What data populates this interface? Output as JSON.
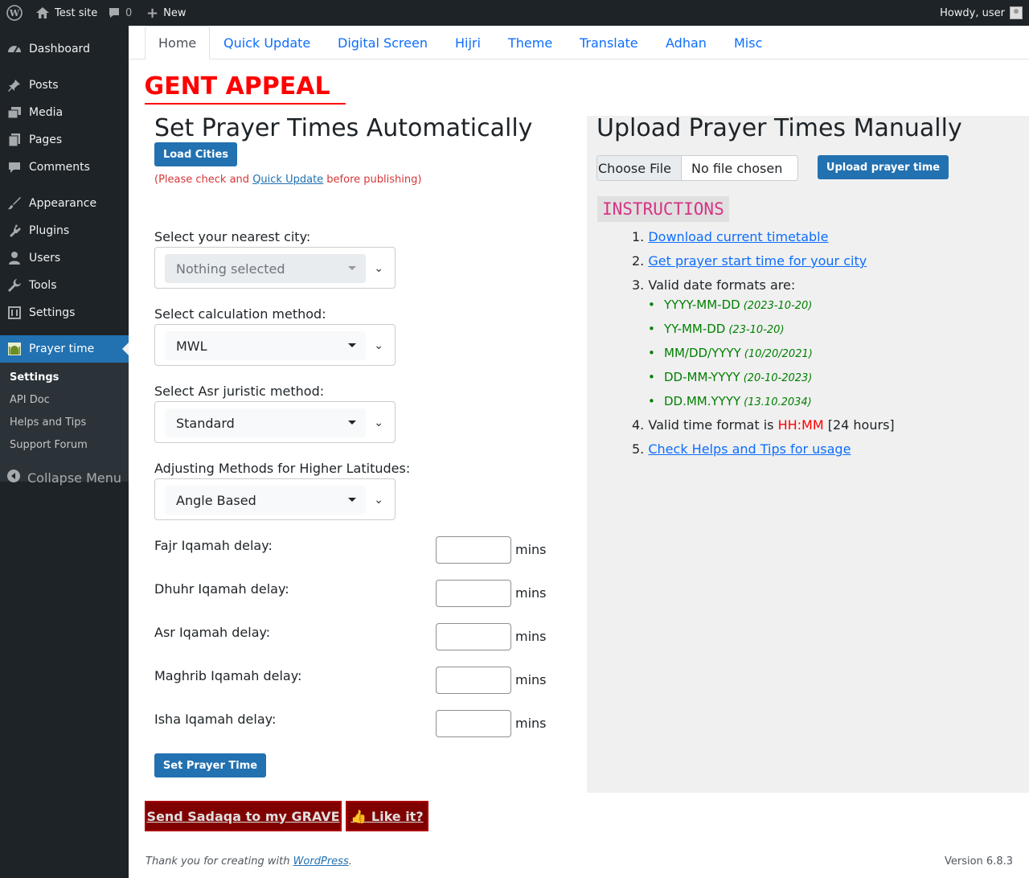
{
  "adminbar": {
    "site_name": "Test site",
    "comments_count": "0",
    "new_label": "New",
    "howdy": "Howdy, user"
  },
  "sidebar": {
    "items": [
      {
        "label": "Dashboard",
        "icon": "dashboard-icon"
      },
      {
        "label": "Posts",
        "icon": "pin-icon"
      },
      {
        "label": "Media",
        "icon": "media-icon"
      },
      {
        "label": "Pages",
        "icon": "pages-icon"
      },
      {
        "label": "Comments",
        "icon": "comment-icon"
      },
      {
        "label": "Appearance",
        "icon": "brush-icon"
      },
      {
        "label": "Plugins",
        "icon": "plug-icon"
      },
      {
        "label": "Users",
        "icon": "user-icon"
      },
      {
        "label": "Tools",
        "icon": "wrench-icon"
      },
      {
        "label": "Settings",
        "icon": "sliders-icon"
      },
      {
        "label": "Prayer time",
        "icon": "mosque-icon"
      }
    ],
    "submenu": [
      "Settings",
      "API Doc",
      "Helps and Tips",
      "Support Forum"
    ],
    "collapse_label": "Collapse Menu"
  },
  "tabs": [
    "Home",
    "Quick Update",
    "Digital Screen",
    "Hijri",
    "Theme",
    "Translate",
    "Adhan",
    "Misc"
  ],
  "marquee_text": "URGENT APPEAL",
  "auto": {
    "title": "Set Prayer Times Automatically",
    "load_cities": "Load Cities",
    "note_prefix": "(Please check and ",
    "note_link": "Quick Update",
    "note_suffix": " before publishing)",
    "city_label": "Select your nearest city:",
    "city_value": "Nothing selected",
    "method_label": "Select calculation method:",
    "method_value": "MWL",
    "asr_label": "Select Asr juristic method:",
    "asr_value": "Standard",
    "lat_label": "Adjusting Methods for Higher Latitudes:",
    "lat_value": "Angle Based",
    "iqamah": [
      {
        "label": "Fajr Iqamah delay:",
        "value": ""
      },
      {
        "label": "Dhuhr Iqamah delay:",
        "value": ""
      },
      {
        "label": "Asr Iqamah delay:",
        "value": ""
      },
      {
        "label": "Maghrib Iqamah delay:",
        "value": ""
      },
      {
        "label": "Isha Iqamah delay:",
        "value": ""
      }
    ],
    "unit": "mins",
    "submit": "Set Prayer Time"
  },
  "manual": {
    "title": "Upload Prayer Times Manually",
    "choose_file": "Choose File",
    "no_file": "No file chosen",
    "upload_btn": "Upload prayer time",
    "instructions_title": "INSTRUCTIONS",
    "steps": {
      "s1": "Download current timetable",
      "s2": "Get prayer start time for your city",
      "s3": "Valid date formats are:",
      "s4_prefix": "Valid time format is ",
      "s4_highlight": "HH:MM",
      "s4_suffix": " [24 hours]",
      "s5": "Check Helps and Tips for usage"
    },
    "formats": [
      {
        "fmt": "YYYY-MM-DD",
        "ex": "(2023-10-20)"
      },
      {
        "fmt": "YY-MM-DD",
        "ex": "(23-10-20)"
      },
      {
        "fmt": "MM/DD/YYYY",
        "ex": "(10/20/2021)"
      },
      {
        "fmt": "DD-MM-YYYY",
        "ex": "(20-10-2023)"
      },
      {
        "fmt": "DD.MM.YYYY",
        "ex": "(13.10.2034)"
      }
    ]
  },
  "donate": {
    "sadaqa": "Send Sadaqa to my GRAVE",
    "like": "👍 Like it?"
  },
  "footer": {
    "thanks_prefix": "Thank you for creating with ",
    "thanks_link": "WordPress",
    "thanks_suffix": ".",
    "version": "Version 6.8.3"
  }
}
